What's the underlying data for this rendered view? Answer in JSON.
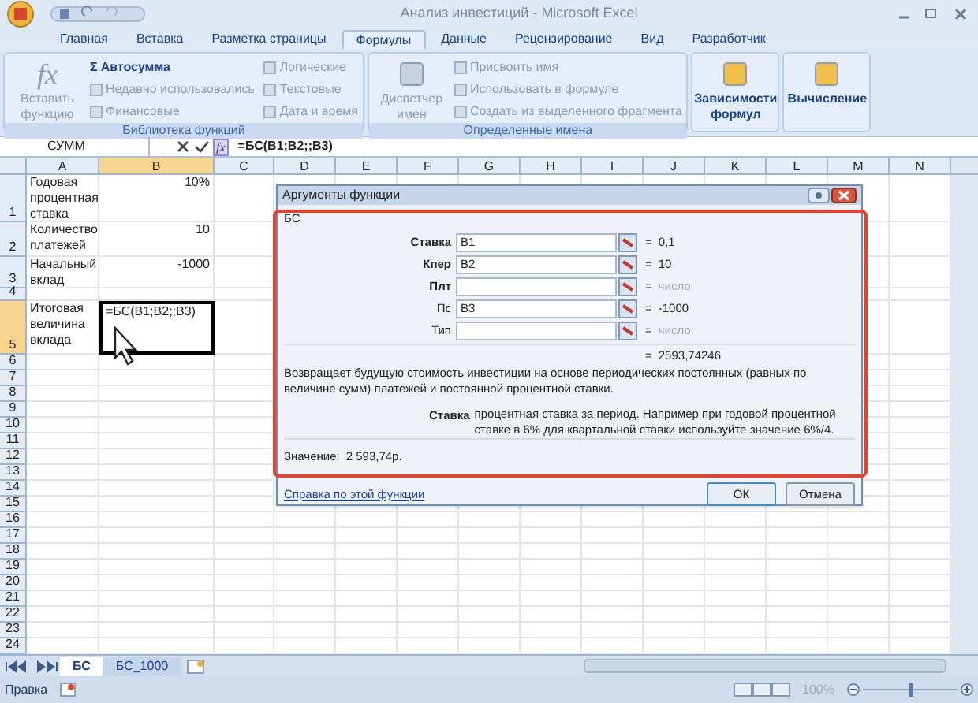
{
  "window": {
    "title": "Анализ инвестиций - Microsoft Excel"
  },
  "ribbon_tabs": [
    {
      "label": "Главная",
      "selected": false
    },
    {
      "label": "Вставка",
      "selected": false
    },
    {
      "label": "Разметка страницы",
      "selected": false
    },
    {
      "label": "Формулы",
      "selected": true
    },
    {
      "label": "Данные",
      "selected": false
    },
    {
      "label": "Рецензирование",
      "selected": false
    },
    {
      "label": "Вид",
      "selected": false
    },
    {
      "label": "Разработчик",
      "selected": false
    }
  ],
  "ribbon_groups": [
    {
      "title": "Библиотека функций",
      "items": [
        {
          "kind": "large",
          "label": "Вставить функцию",
          "glyph": "fx",
          "disabled": true
        },
        {
          "kind": "small",
          "label": "Автосумма",
          "glyph": "Σ",
          "disabled": false
        },
        {
          "kind": "small",
          "label": "Недавно использовались",
          "disabled": true
        },
        {
          "kind": "small",
          "label": "Финансовые",
          "disabled": true
        },
        {
          "kind": "small",
          "label": "Логические",
          "disabled": true
        },
        {
          "kind": "small",
          "label": "Текстовые",
          "disabled": true
        },
        {
          "kind": "small",
          "label": "Дата и время",
          "disabled": true
        }
      ]
    },
    {
      "title": "Определенные имена",
      "items": [
        {
          "kind": "large",
          "label": "Диспетчер имен",
          "disabled": true
        },
        {
          "kind": "small",
          "label": "Присвоить имя",
          "disabled": true
        },
        {
          "kind": "small",
          "label": "Использовать в формуле",
          "disabled": true
        },
        {
          "kind": "small",
          "label": "Создать из выделенного фрагмента",
          "disabled": true
        }
      ]
    },
    {
      "items": [
        {
          "kind": "large",
          "label": "Зависимости формул",
          "disabled": false
        }
      ]
    },
    {
      "items": [
        {
          "kind": "large",
          "label": "Вычисление",
          "disabled": false
        }
      ]
    }
  ],
  "formula_bar": {
    "name_box": "СУММ",
    "fx": "fx",
    "formula": "=БС(B1;B2;;B3)"
  },
  "columns": [
    {
      "label": "A",
      "selected": false
    },
    {
      "label": "B",
      "selected": true
    },
    {
      "label": "C",
      "selected": false
    },
    {
      "label": "D",
      "selected": false
    },
    {
      "label": "E",
      "selected": false
    },
    {
      "label": "F",
      "selected": false
    },
    {
      "label": "G",
      "selected": false
    },
    {
      "label": "H",
      "selected": false
    },
    {
      "label": "I",
      "selected": false
    },
    {
      "label": "J",
      "selected": false
    },
    {
      "label": "K",
      "selected": false
    },
    {
      "label": "L",
      "selected": false
    },
    {
      "label": "M",
      "selected": false
    },
    {
      "label": "N",
      "selected": false
    }
  ],
  "rows": [
    {
      "label": "1",
      "selected": false,
      "cells": [
        {
          "kind": "text",
          "text": "Годовая процентная ставка",
          "selected": false
        },
        {
          "kind": "number",
          "text": "10%",
          "selected": false
        }
      ]
    },
    {
      "label": "2",
      "selected": false,
      "cells": [
        {
          "kind": "text",
          "text": "Количество платежей",
          "selected": false
        },
        {
          "kind": "number",
          "text": "10",
          "selected": false
        }
      ]
    },
    {
      "label": "3",
      "selected": false,
      "cells": [
        {
          "kind": "text",
          "text": "Начальный вклад",
          "selected": false
        },
        {
          "kind": "number",
          "text": "-1000",
          "selected": false
        }
      ]
    },
    {
      "label": "4",
      "selected": false,
      "cells": []
    },
    {
      "label": "5",
      "selected": true,
      "cells": [
        {
          "kind": "text",
          "text": "Итоговая величина вклада",
          "selected": false
        },
        {
          "kind": "text",
          "text": "=БС(B1;B2;;B3)",
          "selected": true
        }
      ]
    },
    {
      "label": "6",
      "selected": false,
      "cells": []
    },
    {
      "label": "7",
      "selected": false,
      "cells": []
    },
    {
      "label": "8",
      "selected": false,
      "cells": []
    },
    {
      "label": "9",
      "selected": false,
      "cells": []
    },
    {
      "label": "10",
      "selected": false,
      "cells": []
    },
    {
      "label": "11",
      "selected": false,
      "cells": []
    },
    {
      "label": "12",
      "selected": false,
      "cells": []
    },
    {
      "label": "13",
      "selected": false,
      "cells": []
    },
    {
      "label": "14",
      "selected": false,
      "cells": []
    },
    {
      "label": "15",
      "selected": false,
      "cells": []
    },
    {
      "label": "16",
      "selected": false,
      "cells": []
    },
    {
      "label": "17",
      "selected": false,
      "cells": []
    },
    {
      "label": "18",
      "selected": false,
      "cells": []
    },
    {
      "label": "19",
      "selected": false,
      "cells": []
    },
    {
      "label": "20",
      "selected": false,
      "cells": []
    },
    {
      "label": "21",
      "selected": false,
      "cells": []
    },
    {
      "label": "22",
      "selected": false,
      "cells": []
    },
    {
      "label": "23",
      "selected": false,
      "cells": []
    },
    {
      "label": "24",
      "selected": false,
      "cells": []
    }
  ],
  "dialog": {
    "title": "Аргументы функции",
    "function": "БС",
    "arguments": [
      {
        "label": "Ставка",
        "required": true,
        "value": "B1",
        "eq": "=",
        "result": "0,1",
        "hint": false
      },
      {
        "label": "Кпер",
        "required": true,
        "value": "B2",
        "eq": "=",
        "result": "10",
        "hint": false
      },
      {
        "label": "Плт",
        "required": true,
        "eq": "=",
        "result": "число",
        "hint": true
      },
      {
        "label": "Пс",
        "required": false,
        "value": "B3",
        "eq": "=",
        "result": "-1000",
        "hint": false
      },
      {
        "label": "Тип",
        "required": false,
        "eq": "=",
        "result": "число",
        "hint": true
      }
    ],
    "total_eq": "=",
    "total": "2593,74246",
    "description": "Возвращает будущую стоимость инвестиции на основе периодических постоянных (равных по величине сумм) платежей и постоянной процентной ставки.",
    "arg_name": "Ставка",
    "arg_help": "процентная ставка за период. Например при годовой процентной ставке в 6% для квартальной ставки используйте значение 6%/4.",
    "value_label": "Значение:",
    "value": "2 593,74р.",
    "help_link": "Справка по этой функции",
    "buttons": [
      {
        "label": "ОК",
        "selected": true
      },
      {
        "label": "Отмена",
        "selected": false
      }
    ]
  },
  "sheet_tabs": [
    {
      "label": "БС",
      "selected": true
    },
    {
      "label": "БС_1000",
      "selected": false
    }
  ],
  "status_bar": {
    "mode": "Правка",
    "zoom": "100%",
    "zoom_slider": {
      "level": 0.5
    }
  }
}
